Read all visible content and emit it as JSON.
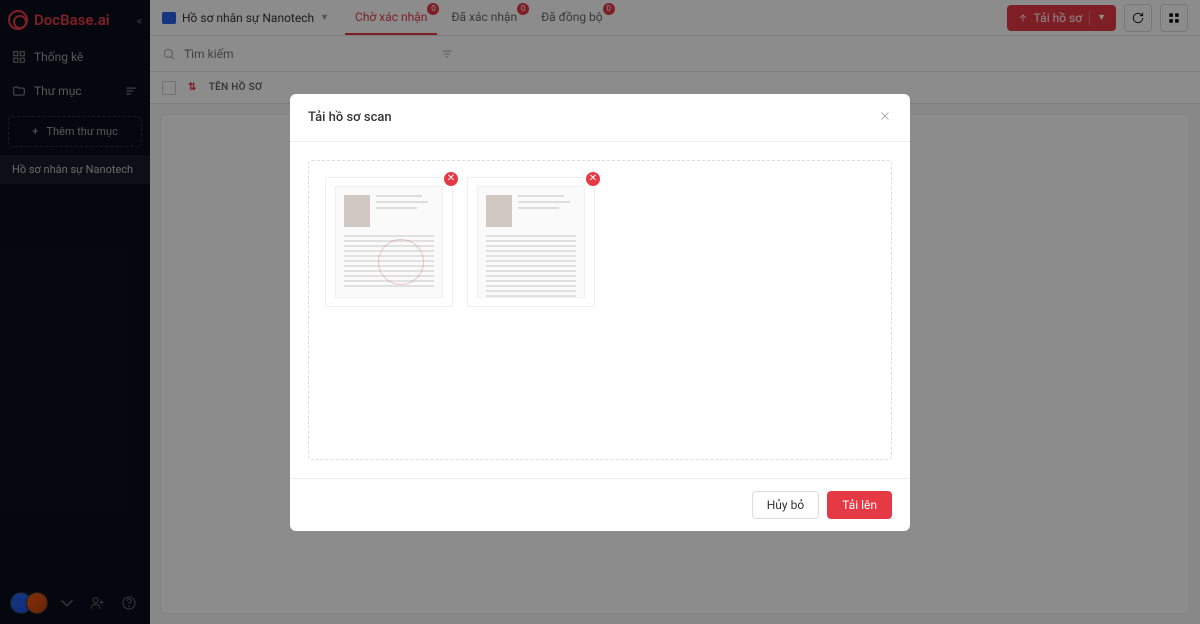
{
  "app": {
    "name": "DocBase.ai"
  },
  "sidebar": {
    "stats": "Thống kê",
    "folders": "Thư mục",
    "add_folder": "Thêm thư mục",
    "selected_folder": "Hồ sơ nhân sự Nanotech"
  },
  "breadcrumb": {
    "folder": "Hồ sơ nhân sự Nanotech"
  },
  "tabs": [
    {
      "label": "Chờ xác nhận",
      "badge": "0",
      "active": true
    },
    {
      "label": "Đã xác nhận",
      "badge": "0",
      "active": false
    },
    {
      "label": "Đã đồng bộ",
      "badge": "0",
      "active": false
    }
  ],
  "actions": {
    "upload": "Tải hồ sơ"
  },
  "search": {
    "placeholder": "Tìm kiếm"
  },
  "table": {
    "col_name": "TÊN HỒ SƠ"
  },
  "modal": {
    "title": "Tải hồ sơ scan",
    "cancel": "Hủy bỏ",
    "confirm": "Tải lên",
    "files": [
      {
        "id": "file-1"
      },
      {
        "id": "file-2"
      }
    ]
  }
}
